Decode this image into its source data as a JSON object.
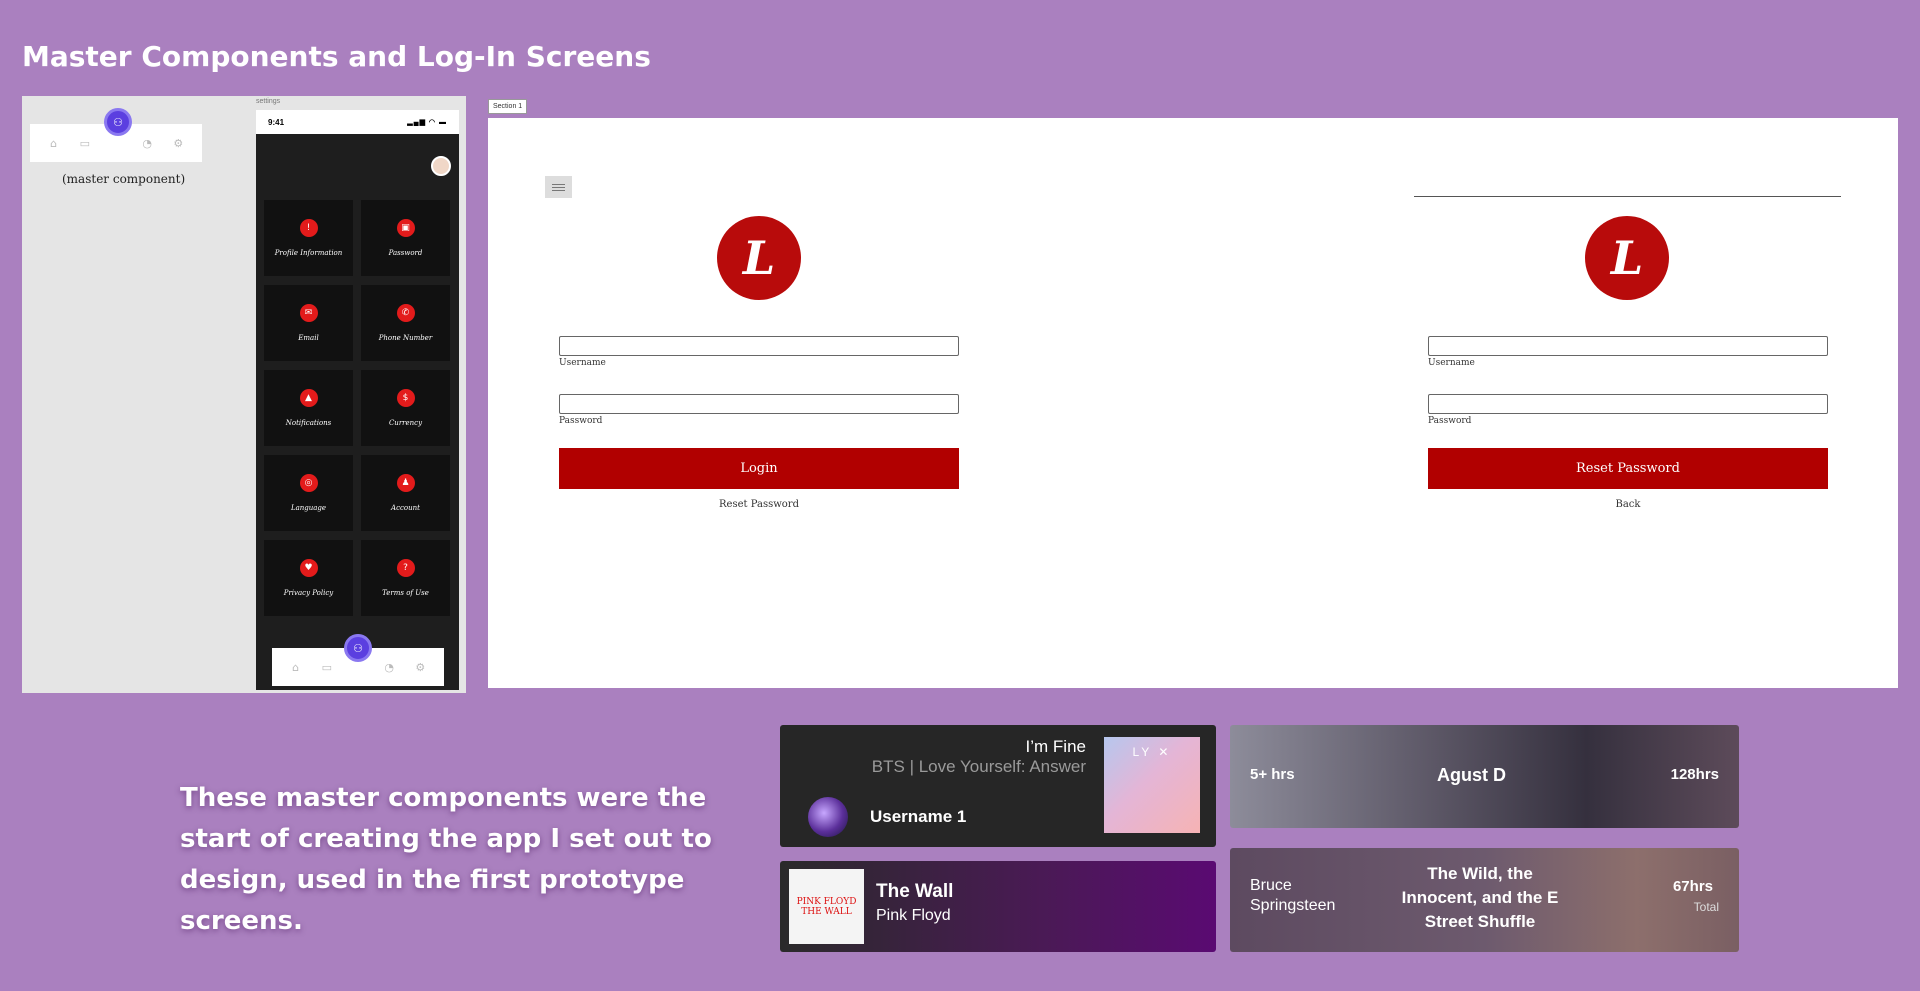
{
  "page": {
    "title": "Master Components and Log-In Screens"
  },
  "master": {
    "caption": "(master component)",
    "nav_icons": [
      "home-icon",
      "wallet-icon",
      "robot-icon",
      "pie-chart-icon",
      "gear-icon"
    ]
  },
  "phone": {
    "label": "settings",
    "time": "9:41",
    "tiles": [
      {
        "label": "Profile Information",
        "icon": "info-icon",
        "glyph": "!"
      },
      {
        "label": "Password",
        "icon": "lock-icon",
        "glyph": "🔒"
      },
      {
        "label": "Email",
        "icon": "mail-icon",
        "glyph": "✉"
      },
      {
        "label": "Phone Number",
        "icon": "phone-icon",
        "glyph": "✆"
      },
      {
        "label": "Notifications",
        "icon": "bell-icon",
        "glyph": "♪"
      },
      {
        "label": "Currency",
        "icon": "dollar-icon",
        "glyph": "$"
      },
      {
        "label": "Language",
        "icon": "globe-icon",
        "glyph": "◎"
      },
      {
        "label": "Account",
        "icon": "user-icon",
        "glyph": "♟"
      },
      {
        "label": "Privacy Policy",
        "icon": "shield-icon",
        "glyph": "♥"
      },
      {
        "label": "Terms of Use",
        "icon": "question-icon",
        "glyph": "?"
      }
    ]
  },
  "section": {
    "tag": "Section 1",
    "logo_letter": "L",
    "login": {
      "username_label": "Username",
      "password_label": "Password",
      "button": "Login",
      "link": "Reset Password"
    },
    "reset": {
      "username_label": "Username",
      "password_label": "Password",
      "button": "Reset Password",
      "link": "Back"
    }
  },
  "description": "These master components were the start of creating the app I set out to design, used in the first prototype screens.",
  "cards": {
    "now_playing": {
      "song": "I’m Fine",
      "artist": "BTS | Love Yourself: Answer",
      "cover_text": "LY ✕",
      "username": "Username 1"
    },
    "album": {
      "title": "The Wall",
      "artist": "Pink Floyd",
      "cover_text": "PINK FLOYD THE WALL"
    },
    "artist_stat": {
      "left": "5+ hrs",
      "name": "Agust D",
      "right": "128hrs"
    },
    "album_stat": {
      "artist": "Bruce Springsteen",
      "album": "The Wild, the Innocent, and the E Street Shuffle",
      "hours": "67hrs",
      "total": "Total"
    }
  },
  "colors": {
    "background": "#aa80bf",
    "brand_red": "#b10000",
    "accent_purple": "#5b3fe0"
  }
}
